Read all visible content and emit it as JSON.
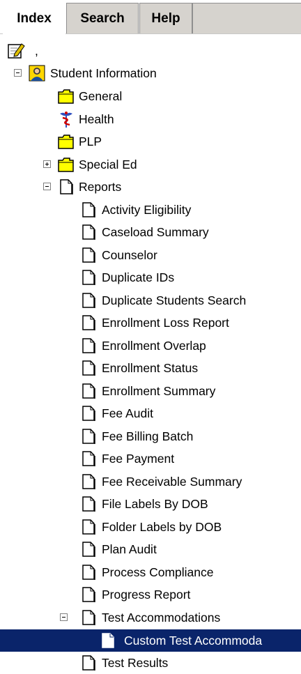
{
  "tabs": [
    {
      "label": "Index",
      "active": true
    },
    {
      "label": "Search",
      "active": false
    },
    {
      "label": "Help",
      "active": false
    }
  ],
  "root": {
    "label": ",",
    "icon": "edit-notepad-icon"
  },
  "tree": [
    {
      "label": "Student Information",
      "icon": "student-icon",
      "expander": "minus"
    },
    {
      "label": "General",
      "icon": "folder-icon"
    },
    {
      "label": "Health",
      "icon": "caduceus-icon"
    },
    {
      "label": "PLP",
      "icon": "folder-icon"
    },
    {
      "label": "Special Ed",
      "icon": "folder-icon",
      "expander": "plus"
    },
    {
      "label": "Reports",
      "icon": "document-icon",
      "expander": "minus"
    },
    {
      "label": "Activity Eligibility",
      "icon": "document-icon"
    },
    {
      "label": "Caseload Summary",
      "icon": "document-icon"
    },
    {
      "label": "Counselor",
      "icon": "document-icon"
    },
    {
      "label": "Duplicate IDs",
      "icon": "document-icon"
    },
    {
      "label": "Duplicate Students Search",
      "icon": "document-icon"
    },
    {
      "label": "Enrollment Loss Report",
      "icon": "document-icon"
    },
    {
      "label": "Enrollment Overlap",
      "icon": "document-icon"
    },
    {
      "label": "Enrollment Status",
      "icon": "document-icon"
    },
    {
      "label": "Enrollment Summary",
      "icon": "document-icon"
    },
    {
      "label": "Fee Audit",
      "icon": "document-icon"
    },
    {
      "label": "Fee Billing Batch",
      "icon": "document-icon"
    },
    {
      "label": "Fee Payment",
      "icon": "document-icon"
    },
    {
      "label": "Fee Receivable Summary",
      "icon": "document-icon"
    },
    {
      "label": "File Labels By DOB",
      "icon": "document-icon"
    },
    {
      "label": "Folder Labels by DOB",
      "icon": "document-icon"
    },
    {
      "label": "Plan Audit",
      "icon": "document-icon"
    },
    {
      "label": "Process Compliance",
      "icon": "document-icon"
    },
    {
      "label": "Progress Report",
      "icon": "document-icon"
    },
    {
      "label": "Test Accommodations",
      "icon": "document-icon",
      "expander": "minus"
    },
    {
      "label": "Custom Test Accommoda",
      "icon": "document-icon",
      "selected": true
    },
    {
      "label": "Test Results",
      "icon": "document-icon"
    }
  ],
  "colors": {
    "selection": "#0a246a",
    "tab_face": "#d6d3ce",
    "folder_yellow": "#ffff00"
  }
}
